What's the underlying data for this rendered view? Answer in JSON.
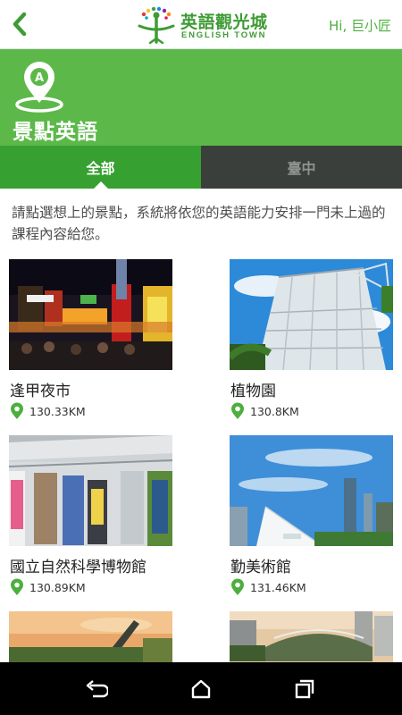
{
  "header": {
    "logo_cn": "英語觀光城",
    "logo_en": "ENGLISH TOWN",
    "greeting": "Hi, 巨小匠",
    "back_icon": "chevron-left-icon"
  },
  "hero": {
    "pin_letter": "A",
    "title": "景點英語"
  },
  "tabs": [
    {
      "label": "全部",
      "active": true
    },
    {
      "label": "臺中",
      "active": false
    }
  ],
  "description": "請點選想上的景點，系統將依您的英語能力安排一門未上過的課程內容給您。",
  "spots": [
    {
      "name": "逢甲夜市",
      "distance": "130.33KM"
    },
    {
      "name": "植物園",
      "distance": "130.8KM"
    },
    {
      "name": "國立自然科學博物館",
      "distance": "130.89KM"
    },
    {
      "name": "勤美術館",
      "distance": "131.46KM"
    },
    {
      "name": "",
      "distance": ""
    },
    {
      "name": "",
      "distance": ""
    }
  ],
  "colors": {
    "brand_green": "#5cb949",
    "tab_active": "#36a031",
    "tab_inactive": "#3b3f3b"
  },
  "navbar": {
    "icons": [
      "back-icon",
      "home-icon",
      "recents-icon"
    ]
  }
}
